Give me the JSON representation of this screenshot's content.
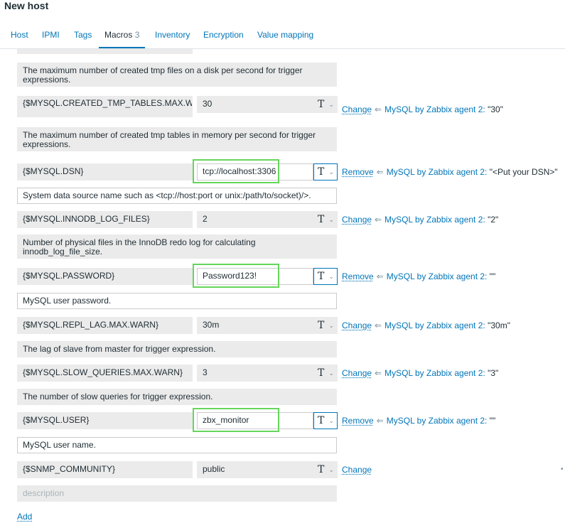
{
  "page": {
    "title": "New host"
  },
  "tabs": [
    {
      "label": "Host"
    },
    {
      "label": "IPMI"
    },
    {
      "label": "Tags"
    },
    {
      "label": "Macros",
      "count": "3"
    },
    {
      "label": "Inventory"
    },
    {
      "label": "Encryption"
    },
    {
      "label": "Value mapping"
    }
  ],
  "macros": [
    {
      "name": "{$MYSQL.CREATED_TMP_TABLES.MAX.WARN}",
      "value": "30",
      "action": "Change",
      "template": "MySQL by Zabbix agent 2:",
      "template_value": "\"30\"",
      "description": "The maximum number of created tmp tables in memory per second for trigger expressions."
    },
    {
      "name": "{$MYSQL.DSN}",
      "value": "tcp://localhost:3306",
      "action": "Remove",
      "template": "MySQL by Zabbix agent 2:",
      "template_value": "\"<Put your DSN>\"",
      "description": "System data source name such as <tcp://host:port or unix:/path/to/socket)/>."
    },
    {
      "name": "{$MYSQL.INNODB_LOG_FILES}",
      "value": "2",
      "action": "Change",
      "template": "MySQL by Zabbix agent 2:",
      "template_value": "\"2\"",
      "description": "Number of physical files in the InnoDB redo log for calculating innodb_log_file_size."
    },
    {
      "name": "{$MYSQL.PASSWORD}",
      "value": "Password123!",
      "action": "Remove",
      "template": "MySQL by Zabbix agent 2:",
      "template_value": "\"\"",
      "description": "MySQL user password."
    },
    {
      "name": "{$MYSQL.REPL_LAG.MAX.WARN}",
      "value": "30m",
      "action": "Change",
      "template": "MySQL by Zabbix agent 2:",
      "template_value": "\"30m\"",
      "description": "The lag of slave from master for trigger expression."
    },
    {
      "name": "{$MYSQL.SLOW_QUERIES.MAX.WARN}",
      "value": "3",
      "action": "Change",
      "template": "MySQL by Zabbix agent 2:",
      "template_value": "\"3\"",
      "description": "The number of slow queries for trigger expression."
    },
    {
      "name": "{$MYSQL.USER}",
      "value": "zbx_monitor",
      "action": "Remove",
      "template": "MySQL by Zabbix agent 2:",
      "template_value": "\"\"",
      "description": "MySQL user name."
    },
    {
      "name": "{$SNMP_COMMUNITY}",
      "value": "public",
      "action": "Change"
    }
  ],
  "top_description": "The maximum number of created tmp files on a disk per second for trigger expressions.",
  "type_glyph": "T",
  "new_description_placeholder": "description",
  "add_label": "Add",
  "colors": {
    "link": "#0275b8",
    "highlight": "#65d65b",
    "field_bg": "#ebebeb"
  }
}
